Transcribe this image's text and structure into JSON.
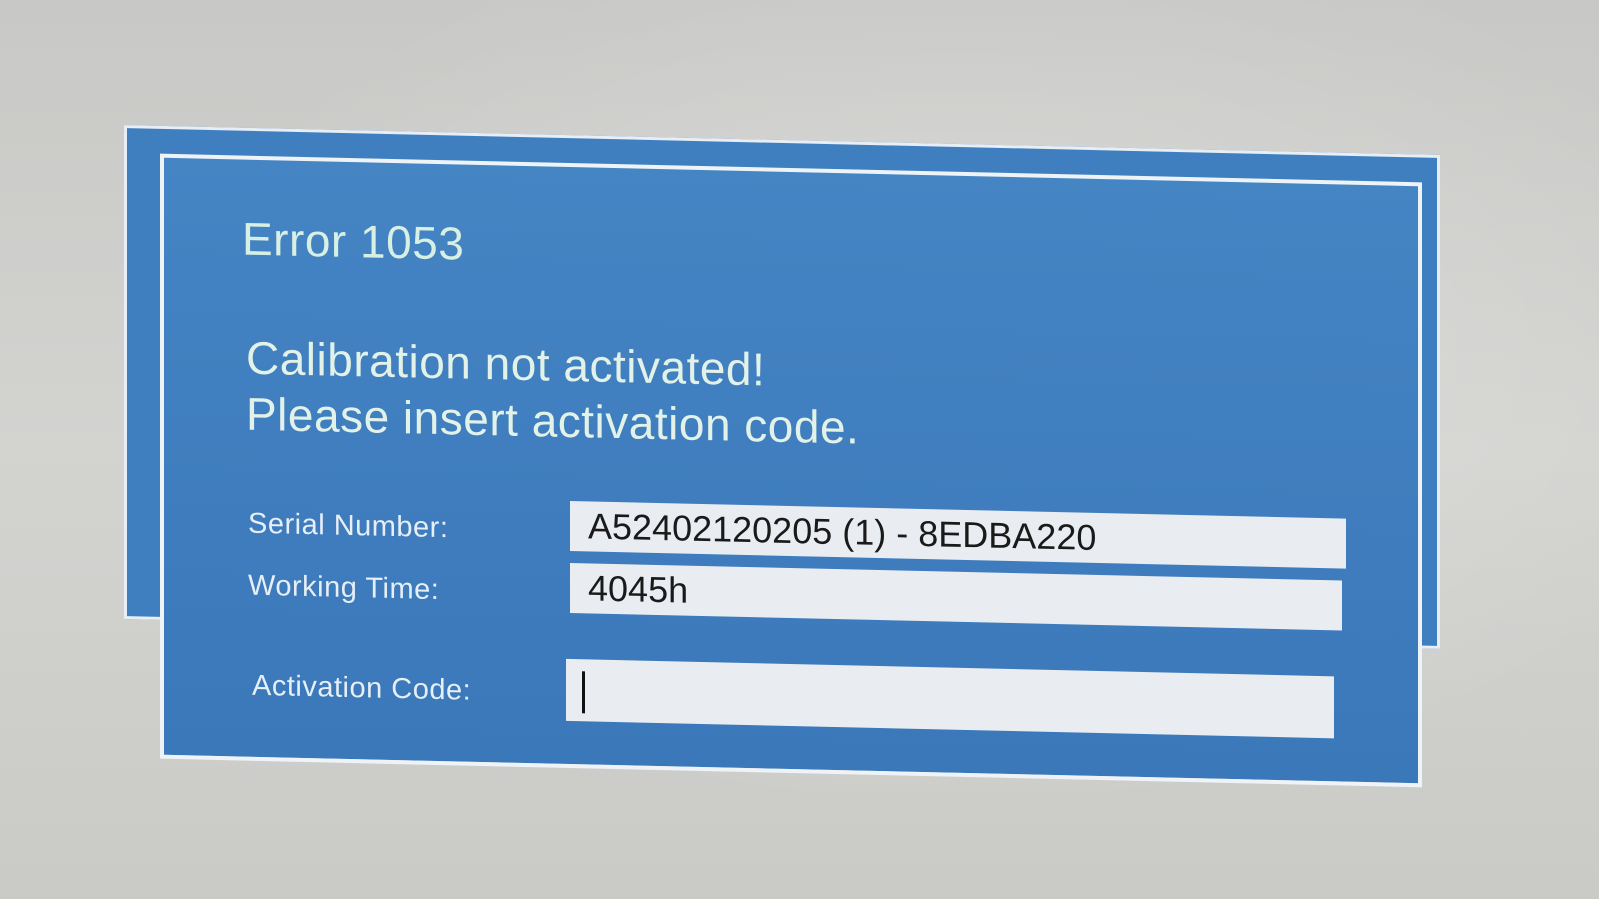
{
  "dialog": {
    "title": "Error 1053",
    "message_line1": "Calibration not activated!",
    "message_line2": "Please insert activation code."
  },
  "fields": {
    "serial_number": {
      "label": "Serial Number:",
      "value": "A52402120205 (1) - 8EDBA220"
    },
    "working_time": {
      "label": "Working Time:",
      "value": "4045h"
    },
    "activation_code": {
      "label": "Activation Code:",
      "value": ""
    }
  },
  "colors": {
    "dialog_background": "#3f7dbe",
    "dialog_border": "#eef3f8",
    "title_text": "#d8f0e4",
    "field_background": "#e9edf2"
  }
}
